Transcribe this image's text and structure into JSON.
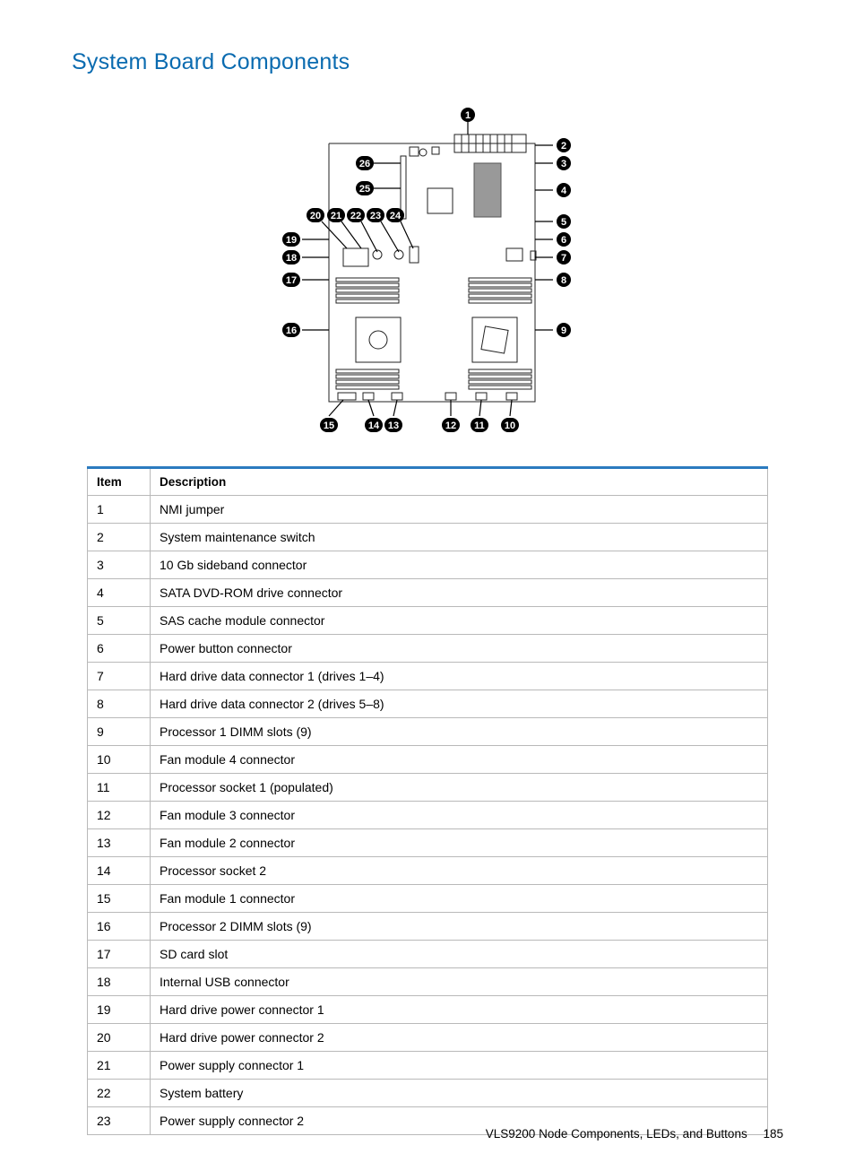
{
  "heading": "System Board Components",
  "table": {
    "headers": {
      "item": "Item",
      "desc": "Description"
    },
    "rows": [
      {
        "item": "1",
        "desc": "NMI jumper"
      },
      {
        "item": "2",
        "desc": "System maintenance switch"
      },
      {
        "item": "3",
        "desc": "10 Gb sideband connector"
      },
      {
        "item": "4",
        "desc": "SATA DVD-ROM drive connector"
      },
      {
        "item": "5",
        "desc": "SAS cache module connector"
      },
      {
        "item": "6",
        "desc": "Power button connector"
      },
      {
        "item": "7",
        "desc": "Hard drive data connector 1 (drives 1–4)"
      },
      {
        "item": "8",
        "desc": "Hard drive data connector 2 (drives 5–8)"
      },
      {
        "item": "9",
        "desc": "Processor 1 DIMM slots (9)"
      },
      {
        "item": "10",
        "desc": "Fan module 4 connector"
      },
      {
        "item": "11",
        "desc": "Processor socket 1 (populated)"
      },
      {
        "item": "12",
        "desc": "Fan module 3 connector"
      },
      {
        "item": "13",
        "desc": "Fan module 2 connector"
      },
      {
        "item": "14",
        "desc": "Processor socket 2"
      },
      {
        "item": "15",
        "desc": "Fan module 1 connector"
      },
      {
        "item": "16",
        "desc": "Processor 2 DIMM slots (9)"
      },
      {
        "item": "17",
        "desc": "SD card slot"
      },
      {
        "item": "18",
        "desc": "Internal USB connector"
      },
      {
        "item": "19",
        "desc": "Hard drive power connector 1"
      },
      {
        "item": "20",
        "desc": "Hard drive power connector 2"
      },
      {
        "item": "21",
        "desc": "Power supply connector 1"
      },
      {
        "item": "22",
        "desc": "System battery"
      },
      {
        "item": "23",
        "desc": "Power supply connector 2"
      }
    ]
  },
  "callouts": [
    "1",
    "2",
    "3",
    "4",
    "5",
    "6",
    "7",
    "8",
    "9",
    "10",
    "11",
    "12",
    "13",
    "14",
    "15",
    "16",
    "17",
    "18",
    "19",
    "20",
    "21",
    "22",
    "23",
    "24",
    "25",
    "26"
  ],
  "footer": {
    "section": "VLS9200 Node Components, LEDs, and Buttons",
    "page": "185"
  }
}
